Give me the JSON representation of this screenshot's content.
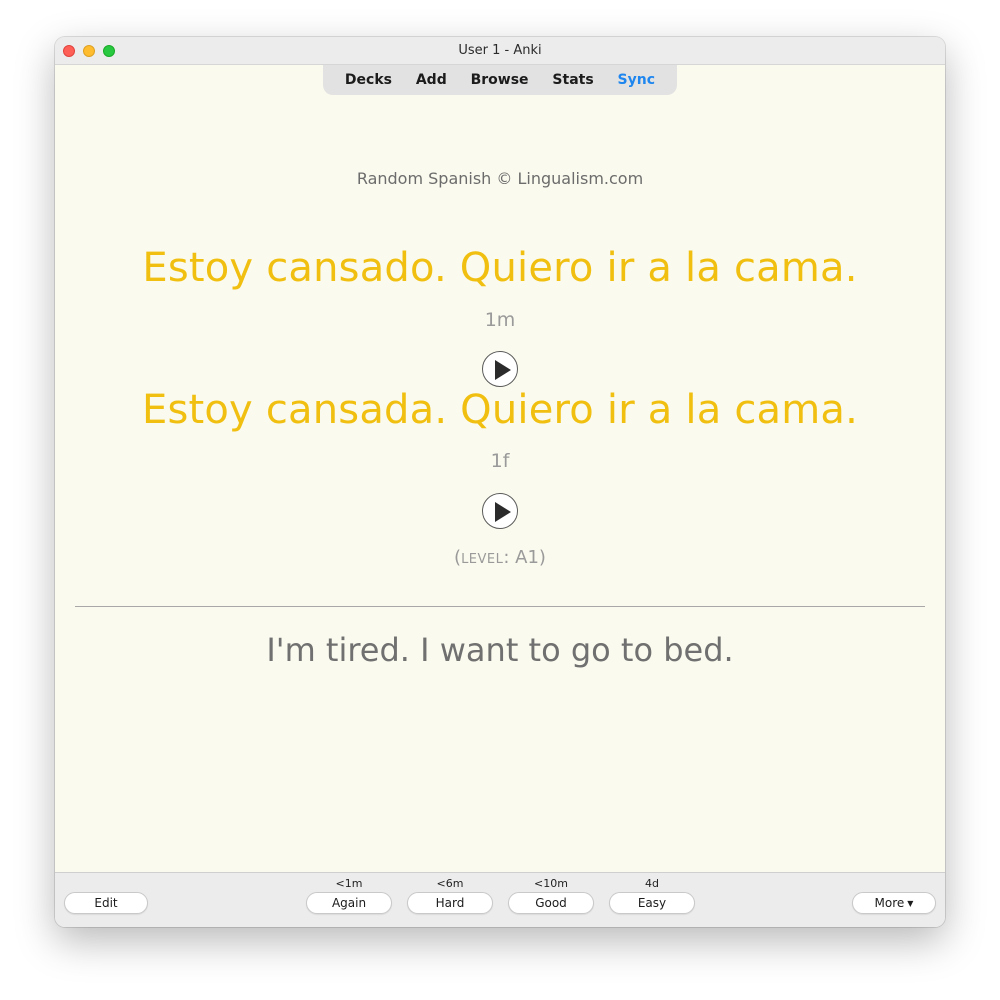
{
  "window": {
    "title": "User 1 - Anki"
  },
  "toolbar": {
    "decks": "Decks",
    "add": "Add",
    "browse": "Browse",
    "stats": "Stats",
    "sync": "Sync"
  },
  "card": {
    "credit": "Random Spanish © Lingualism.com",
    "sentence_1": "Estoy cansado. Quiero ir a la cama.",
    "tag_1": "1m",
    "sentence_2": "Estoy cansada. Quiero ir a la cama.",
    "tag_2": "1f",
    "level_open": "(",
    "level_word": "level",
    "level_value": ": A1)",
    "answer": "I'm tired. I want to go to bed."
  },
  "bottom": {
    "edit": "Edit",
    "more": "More",
    "answers": [
      {
        "interval": "<1m",
        "label": "Again"
      },
      {
        "interval": "<6m",
        "label": "Hard"
      },
      {
        "interval": "<10m",
        "label": "Good"
      },
      {
        "interval": "4d",
        "label": "Easy"
      }
    ]
  },
  "icons": {
    "play": "play-icon",
    "dropdown": "caret-down-icon"
  },
  "colors": {
    "card_background": "#fafaee",
    "sentence": "#f0bf10",
    "sync_link": "#1e86ee",
    "answer_text": "#707070"
  }
}
